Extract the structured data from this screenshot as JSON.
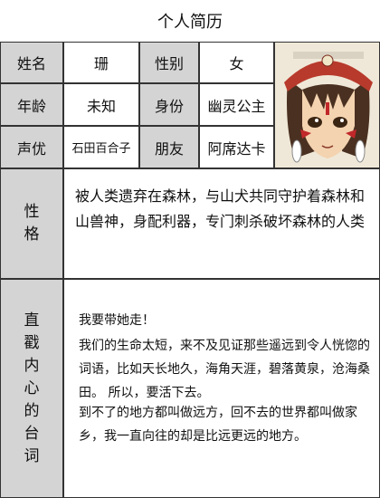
{
  "page": {
    "title": "个人简历"
  },
  "fields": [
    {
      "label": "姓名",
      "value": "珊"
    },
    {
      "label": "性别",
      "value": "女"
    },
    {
      "label": "年龄",
      "value": "未知"
    },
    {
      "label": "身份",
      "value": "幽灵公主"
    },
    {
      "label": "声优",
      "value": "石田百合子"
    },
    {
      "label": "朋友",
      "value": "阿席达卡"
    }
  ],
  "personality": {
    "label_chars": [
      "性",
      "格"
    ],
    "text": "被人类遗弃在森林，与山犬共同守护着森林和山兽神，身配利器，专门刺杀破坏森林的人类"
  },
  "quotes": {
    "label_chars": [
      "直",
      "戳",
      "内",
      "心",
      "的",
      "台",
      "词"
    ],
    "lines": [
      "我要带她走！",
      "我们的生命太短，来不及见证那些遥远到令人恍惚的词语，比如天长地久，海角天涯，碧落黄泉，沧海桑田。 所以，要活下去。",
      "到不了的地方都叫做远方，回不去的世界都叫做家乡，我一直向往的却是比远更远的地方。"
    ]
  },
  "colors": {
    "label_bg": "#d4d4d4",
    "border": "#333333",
    "face_paint": "#c0282a",
    "mask": "#b83a2c"
  }
}
